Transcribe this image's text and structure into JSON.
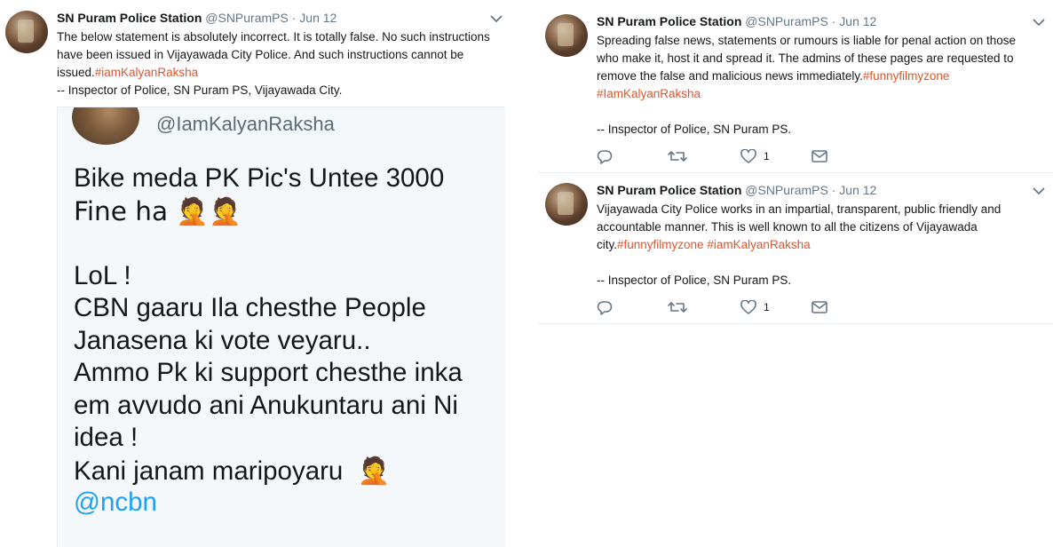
{
  "left_tweet": {
    "name": "SN Puram Police Station",
    "handle": "@SNPuramPS",
    "dot": "·",
    "date": "Jun 12",
    "text_lines": [
      "The below statement is absolutely incorrect. It is totally false. No such instructions",
      "have been issued in Vijayawada City Police. And such instructions cannot be",
      "issued."
    ],
    "hashtag": "#iamKalyanRaksha",
    "signature": "-- Inspector of Police, SN Puram PS, Vijayawada City.",
    "quoted": {
      "handle": "@IamKalyanRaksha",
      "line1": "Bike meda PK Pic's Untee 3000",
      "line2": "Fine ha 🤦🤦",
      "line3": "LoL !",
      "line4": "CBN gaaru Ila chesthe People",
      "line5": "Janasena ki vote veyaru..",
      "line6": "Ammo Pk ki support chesthe inka",
      "line7": "em avvudo ani Anukuntaru ani Ni",
      "line8": "idea !",
      "line9": "Kani janam maripoyaru",
      "line9_emoji": "🤦",
      "mention": "@ncbn"
    }
  },
  "right_tweets": [
    {
      "name": "SN Puram Police Station",
      "handle": "@SNPuramPS",
      "dot": "·",
      "date": "Jun 12",
      "line1": "Spreading false news, statements or rumours is liable for penal action on those",
      "line2": "who make it, host it and spread it. The admins of these pages are requested to",
      "line3": "remove the false and malicious news immediately.",
      "tag1": "#funnyfilmyzone",
      "tag2": "#IamKalyanRaksha",
      "signature": "-- Inspector of Police, SN Puram PS.",
      "like_count": "1"
    },
    {
      "name": "SN Puram Police Station",
      "handle": "@SNPuramPS",
      "dot": "·",
      "date": "Jun 12",
      "line1": "Vijayawada City Police works in an impartial, transparent, public friendly and",
      "line2": "accountable manner. This is well known to all the citizens of Vijayawada",
      "line3": "city.",
      "tag1": "#funnyfilmyzone",
      "tag2": "#iamKalyanRaksha",
      "signature": "-- Inspector of Police, SN Puram PS.",
      "like_count": "1"
    }
  ],
  "icons": {
    "reply": "reply-icon",
    "retweet": "retweet-icon",
    "like": "heart-icon",
    "message": "envelope-icon",
    "more": "chevron-down-icon"
  },
  "colors": {
    "hashtag": "#e0552b",
    "mention": "#1da1f2",
    "muted": "#657786"
  }
}
